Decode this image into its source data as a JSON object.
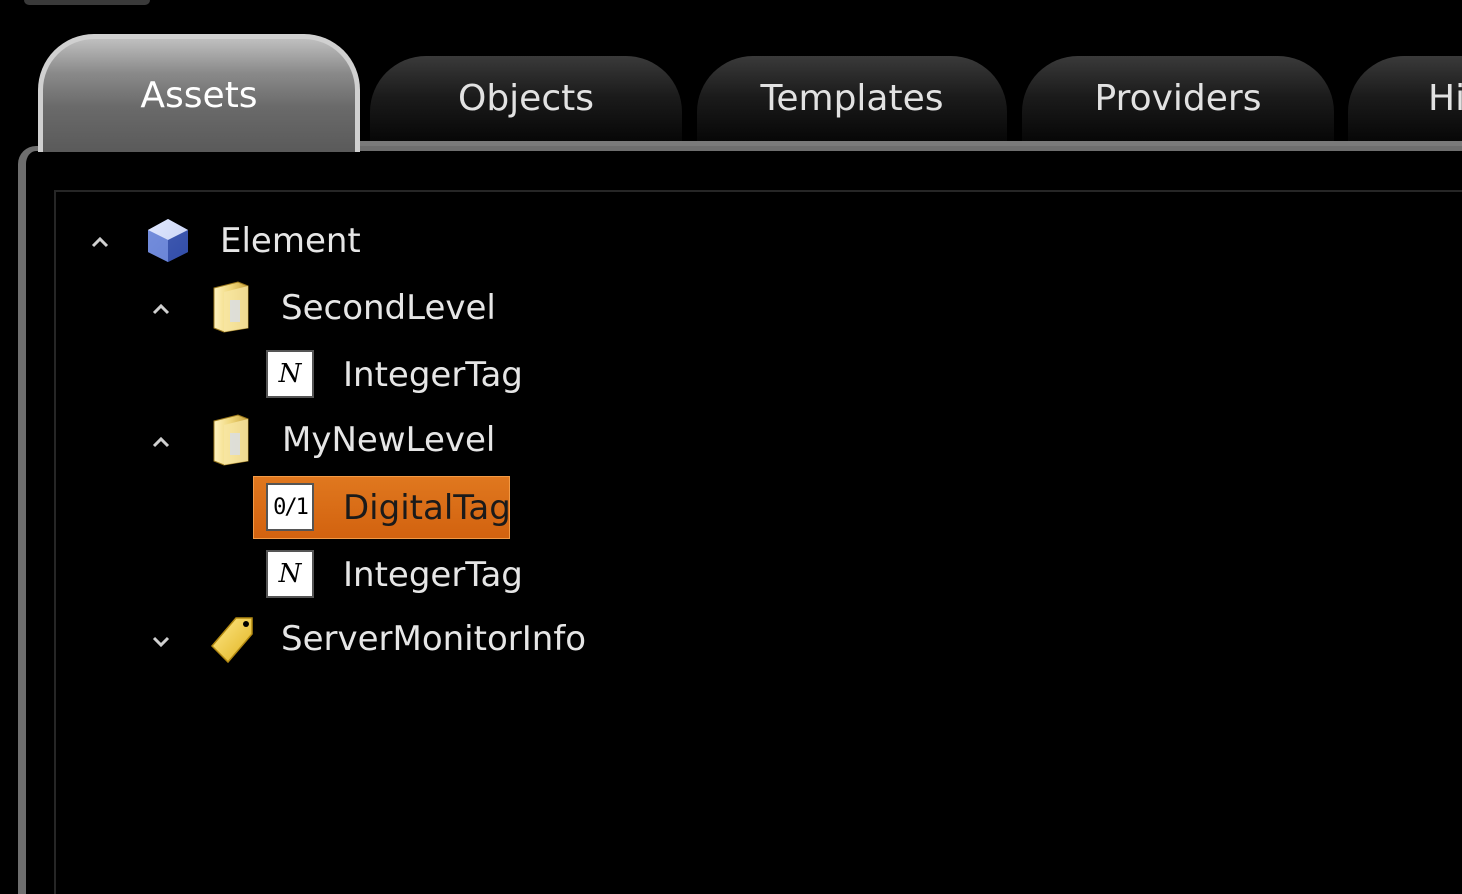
{
  "tabs": [
    {
      "label": "Assets",
      "active": true
    },
    {
      "label": "Objects",
      "active": false
    },
    {
      "label": "Templates",
      "active": false
    },
    {
      "label": "Providers",
      "active": false
    },
    {
      "label": "Hi",
      "active": false
    }
  ],
  "tree": {
    "root": {
      "label": "Element",
      "icon": "element-cube-icon",
      "expanded": true
    },
    "second_level": {
      "label": "SecondLevel",
      "icon": "folder-icon",
      "expanded": true
    },
    "second_level_integer_tag": {
      "label": "IntegerTag",
      "icon_text": "N"
    },
    "my_new_level": {
      "label": "MyNewLevel",
      "icon": "folder-icon",
      "expanded": true
    },
    "digital_tag": {
      "label": "DigitalTag",
      "icon_text": "0/1",
      "selected": true
    },
    "my_new_level_integer_tag": {
      "label": "IntegerTag",
      "icon_text": "N"
    },
    "server_monitor_info": {
      "label": "ServerMonitorInfo",
      "icon": "tag-label-icon",
      "expanded": false
    }
  },
  "colors": {
    "selection": "#d96a14",
    "background": "#000000",
    "active_tab": "#8a8a8a"
  }
}
